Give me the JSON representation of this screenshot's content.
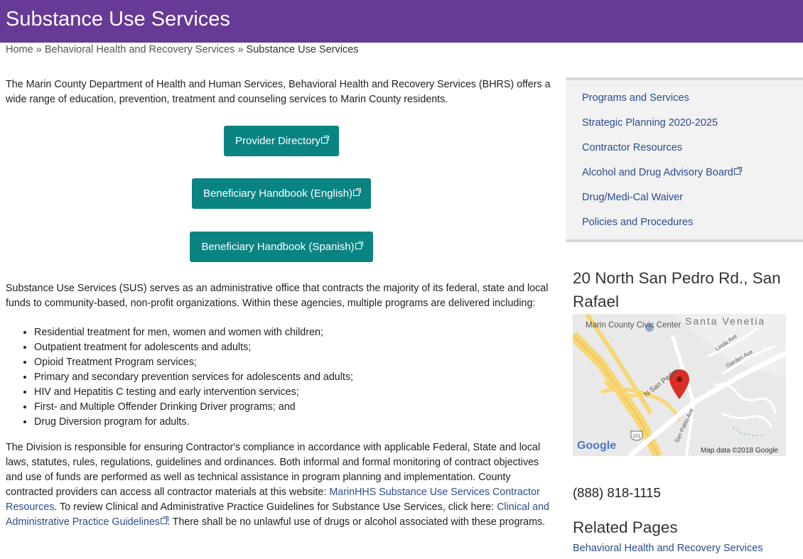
{
  "header": {
    "title": "Substance Use Services"
  },
  "breadcrumb": {
    "home": "Home",
    "sep": "»",
    "parent": "Behavioral Health and Recovery Services",
    "current": "Substance Use Services"
  },
  "main": {
    "intro": "The Marin County Department of Health and Human Services, Behavioral Health and Recovery Services (BHRS) offers a wide range of education, prevention, treatment and counseling services to Marin County residents.",
    "buttons": [
      {
        "label": "Provider Directory"
      },
      {
        "label": "Beneficiary Handbook (English)"
      },
      {
        "label": "Beneficiary Handbook (Spanish)"
      }
    ],
    "para2": "Substance Use Services (SUS) serves as an administrative office that contracts the majority of its federal, state and local funds to community-based, non-profit organizations. Within these agencies, multiple programs are delivered including:",
    "programs": [
      "Residential treatment for men, women and women with children;",
      "Outpatient treatment for adolescents and adults;",
      "Opioid Treatment Program services;",
      "Primary and secondary prevention services for adolescents and adults;",
      "HIV and Hepatitis C testing and early intervention services;",
      "First- and Multiple Offender Drinking Driver programs; and",
      "Drug Diversion program for adults."
    ],
    "para3": {
      "text1": "The Division is responsible for ensuring Contractor's compliance in accordance with applicable Federal, State and local laws, statutes, rules, regulations, guidelines and ordinances. Both informal and formal monitoring of contract objectives and use of funds are performed as well as technical assistance in program planning and implementation. County contracted providers can access all contractor materials at this website: ",
      "link1": "MarinHHS Substance Use Services Contractor Resources",
      "text2": ".  To review Clinical and Administrative Practice Guidelines for Substance Use Services, click here: ",
      "link2": "Clinical and Administrative Practice Guidelines",
      "text3": ".  There shall be no unlawful use of drugs or alcohol associated with these programs."
    }
  },
  "sidebar": {
    "menu": [
      "Programs and Services",
      "Strategic Planning 2020-2025",
      "Contractor Resources",
      "Alcohol and Drug Advisory Board",
      "Drug/Medi-Cal Waiver",
      "Policies and Procedures"
    ],
    "address": "20 North San Pedro Rd., San Rafael",
    "map": {
      "civic_center": "Marin County Civic Center",
      "area": "Santa Venetia",
      "street_n_san_pedro": "N San Pedro",
      "street_linda": "Linda Ave",
      "street_garden": "Garden Ave",
      "street_san_pablo": "San Pablo Ave",
      "highway": "101",
      "logo": "Google",
      "attribution": "Map data ©2018 Google"
    },
    "phone": "(888) 818-1115",
    "related_title": "Related Pages",
    "related_link": "Behavioral Health and Recovery Services"
  },
  "colors": {
    "banner": "#663a96",
    "button": "#0a8383",
    "link": "#2a4d8f",
    "pin": "#d93025"
  }
}
